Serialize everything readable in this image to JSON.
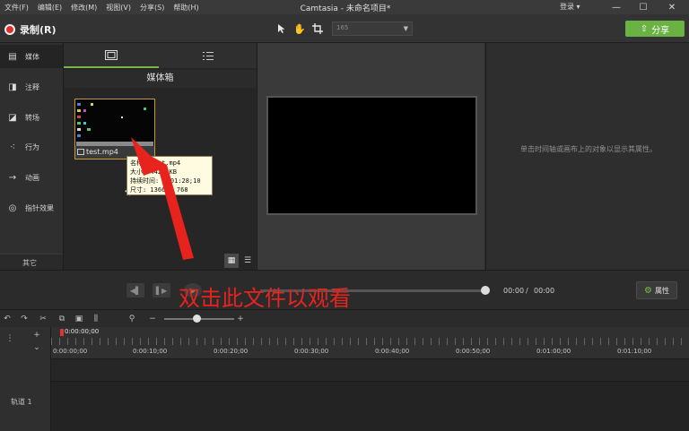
{
  "app": {
    "window_title": "Camtasia - 未命名项目*",
    "menus": [
      "文件(F)",
      "编辑(E)",
      "修改(M)",
      "视图(V)",
      "分享(S)",
      "帮助(H)"
    ],
    "login": "登录 ▾",
    "window_buttons": [
      "—",
      "☐",
      "✕"
    ]
  },
  "toolbar": {
    "record_label": "录制(R)",
    "tools": [
      "select-arrow",
      "pan-hand",
      "crop"
    ],
    "zoom_value": "165",
    "share_label": "分享",
    "accent_color": "#6ab244"
  },
  "rail": {
    "items": [
      {
        "label": "媒体",
        "icon": "film-icon",
        "glyph": "🎞"
      },
      {
        "label": "注释",
        "icon": "callout-icon",
        "glyph": "◨"
      },
      {
        "label": "转场",
        "icon": "transition-icon",
        "glyph": "◪"
      },
      {
        "label": "行为",
        "icon": "behavior-icon",
        "glyph": "⁖"
      },
      {
        "label": "动画",
        "icon": "animation-icon",
        "glyph": "→"
      },
      {
        "label": "指针效果",
        "icon": "cursor-effect-icon",
        "glyph": "◎"
      }
    ],
    "more_label": "其它",
    "add_label": "+"
  },
  "bin": {
    "title": "媒体箱",
    "clip": {
      "name": "test.mp4"
    },
    "tooltip": {
      "line1": "名称: test.mp4",
      "line2": "大小: 4421 KB",
      "line3": "持续时间: 0:01:28;10",
      "line4": "尺寸: 1366 x 768"
    }
  },
  "properties": {
    "hint": "单击时间轴或画布上的对象以显示其属性。",
    "button_label": "属性"
  },
  "playback": {
    "current_time": "00:00",
    "separator": "/",
    "total_time": "00:00"
  },
  "annotation": {
    "text": "双击此文件以观看",
    "color": "#e8231e"
  },
  "timeline": {
    "playhead_time": "0:00:00;00",
    "ruler_labels": [
      "0:00:00;00",
      "0:00:10;00",
      "0:00:20;00",
      "0:00:30;00",
      "0:00:40;00",
      "0:00:50;00",
      "0:01:00;00",
      "0:01:10;00"
    ],
    "track_label": "轨道 1"
  }
}
